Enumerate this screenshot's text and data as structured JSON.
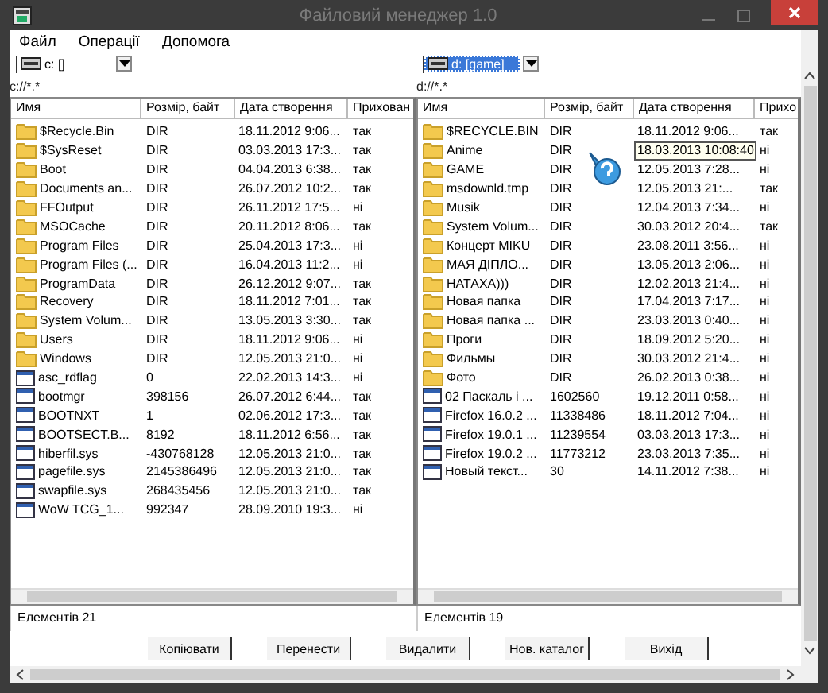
{
  "window": {
    "title": "Файловий менеджер 1.0"
  },
  "menu": [
    "Файл",
    "Операції",
    "Допомога"
  ],
  "panels": [
    {
      "drive": "c: []",
      "drive_selected": false,
      "path": "c://*.*",
      "columns": [
        "Имя",
        "Розмір, байт",
        "Дата створення",
        "Прихован"
      ],
      "status": "Елементів 21",
      "rows": [
        {
          "kind": "folder",
          "name": "$Recycle.Bin",
          "size": "DIR",
          "date": "18.11.2012 9:06...",
          "hidden": "так"
        },
        {
          "kind": "folder",
          "name": "$SysReset",
          "size": "DIR",
          "date": "03.03.2013 17:3...",
          "hidden": "так"
        },
        {
          "kind": "folder",
          "name": "Boot",
          "size": "DIR",
          "date": "04.04.2013 6:38...",
          "hidden": "так"
        },
        {
          "kind": "folder",
          "name": "Documents an...",
          "size": "DIR",
          "date": "26.07.2012 10:2...",
          "hidden": "так"
        },
        {
          "kind": "folder",
          "name": "FFOutput",
          "size": "DIR",
          "date": "26.11.2012 17:5...",
          "hidden": "ні"
        },
        {
          "kind": "folder",
          "name": "MSOCache",
          "size": "DIR",
          "date": "20.11.2012 8:06...",
          "hidden": "так"
        },
        {
          "kind": "folder",
          "name": "Program Files",
          "size": "DIR",
          "date": "25.04.2013 17:3...",
          "hidden": "ні"
        },
        {
          "kind": "folder",
          "name": "Program Files (...",
          "size": "DIR",
          "date": "16.04.2013 11:2...",
          "hidden": "ні"
        },
        {
          "kind": "folder",
          "name": "ProgramData",
          "size": "DIR",
          "date": "26.12.2012 9:07...",
          "hidden": "так"
        },
        {
          "kind": "folder",
          "name": "Recovery",
          "size": "DIR",
          "date": "18.11.2012 7:01...",
          "hidden": "так"
        },
        {
          "kind": "folder",
          "name": "System Volum...",
          "size": "DIR",
          "date": "13.05.2013 3:30...",
          "hidden": "так"
        },
        {
          "kind": "folder",
          "name": "Users",
          "size": "DIR",
          "date": "18.11.2012 9:06...",
          "hidden": "ні"
        },
        {
          "kind": "folder",
          "name": "Windows",
          "size": "DIR",
          "date": "12.05.2013 21:0...",
          "hidden": "ні"
        },
        {
          "kind": "file",
          "name": "asc_rdflag",
          "size": "0",
          "date": "22.02.2013 14:3...",
          "hidden": "ні"
        },
        {
          "kind": "file",
          "name": "bootmgr",
          "size": "398156",
          "date": "26.07.2012 6:44...",
          "hidden": "так"
        },
        {
          "kind": "file",
          "name": "BOOTNXT",
          "size": "1",
          "date": "02.06.2012 17:3...",
          "hidden": "так"
        },
        {
          "kind": "file",
          "name": "BOOTSECT.B...",
          "size": "8192",
          "date": "18.11.2012 6:56...",
          "hidden": "так"
        },
        {
          "kind": "file",
          "name": "hiberfil.sys",
          "size": "-430768128",
          "date": "12.05.2013 21:0...",
          "hidden": "так"
        },
        {
          "kind": "file",
          "name": "pagefile.sys",
          "size": "2145386496",
          "date": "12.05.2013 21:0...",
          "hidden": "так"
        },
        {
          "kind": "file",
          "name": "swapfile.sys",
          "size": "268435456",
          "date": "12.05.2013 21:0...",
          "hidden": "так"
        },
        {
          "kind": "file",
          "name": "WoW TCG_1...",
          "size": "992347",
          "date": "28.09.2010 19:3...",
          "hidden": "ні"
        }
      ]
    },
    {
      "drive": "d: [game]",
      "drive_selected": true,
      "path": "d://*.*",
      "columns": [
        "Имя",
        "Розмір, байт",
        "Дата створення",
        "Прихо"
      ],
      "status": "Елементів 19",
      "rows": [
        {
          "kind": "folder",
          "name": "$RECYCLE.BIN",
          "size": "DIR",
          "date": "18.11.2012 9:06...",
          "hidden": "так"
        },
        {
          "kind": "folder",
          "name": "Anime",
          "size": "DIR",
          "date_tooltip": "18.03.2013 10:08:40",
          "hidden": "ні"
        },
        {
          "kind": "folder",
          "name": "GAME",
          "size": "DIR",
          "date": "12.05.2013 7:28...",
          "hidden": "ні"
        },
        {
          "kind": "folder",
          "name": "msdownld.tmp",
          "size": "DIR",
          "date": "12.05.2013 21:...",
          "hidden": "так"
        },
        {
          "kind": "folder",
          "name": "Musik",
          "size": "DIR",
          "date": "12.04.2013 7:34...",
          "hidden": "ні"
        },
        {
          "kind": "folder",
          "name": "System Volum...",
          "size": "DIR",
          "date": "30.03.2012 20:4...",
          "hidden": "так"
        },
        {
          "kind": "folder",
          "name": "Концерт MIKU",
          "size": "DIR",
          "date": "23.08.2011 3:56...",
          "hidden": "ні"
        },
        {
          "kind": "folder",
          "name": "МАЯ ДІПЛО...",
          "size": "DIR",
          "date": "13.05.2013 2:06...",
          "hidden": "ні"
        },
        {
          "kind": "folder",
          "name": "НАТАХА)))",
          "size": "DIR",
          "date": "12.02.2013 21:4...",
          "hidden": "ні"
        },
        {
          "kind": "folder",
          "name": "Новая папка",
          "size": "DIR",
          "date": "17.04.2013 7:17...",
          "hidden": "ні"
        },
        {
          "kind": "folder",
          "name": "Новая папка ...",
          "size": "DIR",
          "date": "23.03.2013 0:40...",
          "hidden": "ні"
        },
        {
          "kind": "folder",
          "name": "Проги",
          "size": "DIR",
          "date": "18.09.2012 5:20...",
          "hidden": "ні"
        },
        {
          "kind": "folder",
          "name": "Фильмы",
          "size": "DIR",
          "date": "30.03.2012 21:4...",
          "hidden": "ні"
        },
        {
          "kind": "folder",
          "name": "Фото",
          "size": "DIR",
          "date": "26.02.2013 0:38...",
          "hidden": "ні"
        },
        {
          "kind": "file",
          "name": "02 Паскаль і ...",
          "size": "1602560",
          "date": "19.12.2011 0:58...",
          "hidden": "ні"
        },
        {
          "kind": "file",
          "name": "Firefox 16.0.2 ...",
          "size": "11338486",
          "date": "18.11.2012 7:04...",
          "hidden": "ні"
        },
        {
          "kind": "file",
          "name": "Firefox 19.0.1 ...",
          "size": "11239554",
          "date": "03.03.2013 17:3...",
          "hidden": "ні"
        },
        {
          "kind": "file",
          "name": "Firefox 19.0.2 ...",
          "size": "11773212",
          "date": "23.03.2013 7:35...",
          "hidden": "ні"
        },
        {
          "kind": "file",
          "name": "Новый текст...",
          "size": "30",
          "date": "14.11.2012 7:38...",
          "hidden": "ні"
        }
      ]
    }
  ],
  "buttons": [
    "Копіювати",
    "Перенести",
    "Видалити",
    "Нов. каталог",
    "Вихід"
  ]
}
